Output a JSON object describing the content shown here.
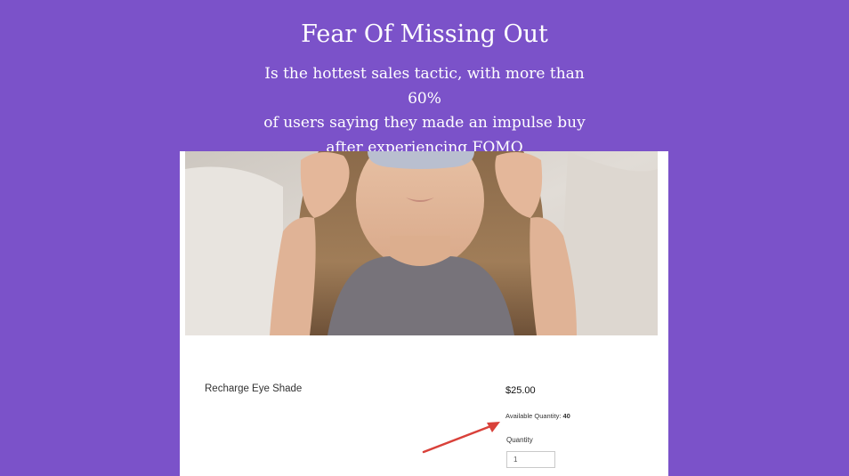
{
  "hero": {
    "title": "Fear Of Missing Out",
    "subtitle_lines": [
      "Is the hottest sales tactic, with more than 60%",
      "of users saying they made an impulse buy",
      "after experiencing FOMO"
    ]
  },
  "product": {
    "image_alt": "Woman lying in bed adjusting a grey sleep eye mask",
    "name": "Recharge Eye Shade",
    "price": "$25.00",
    "availability_label": "Available Quantity:",
    "availability_value": "40",
    "quantity_label": "Quantity",
    "quantity_value": "1"
  },
  "colors": {
    "background": "#7b52c9",
    "card": "#ffffff",
    "annotation_arrow": "#d9413a"
  },
  "icons": {
    "annotation": "red-arrow-icon"
  }
}
